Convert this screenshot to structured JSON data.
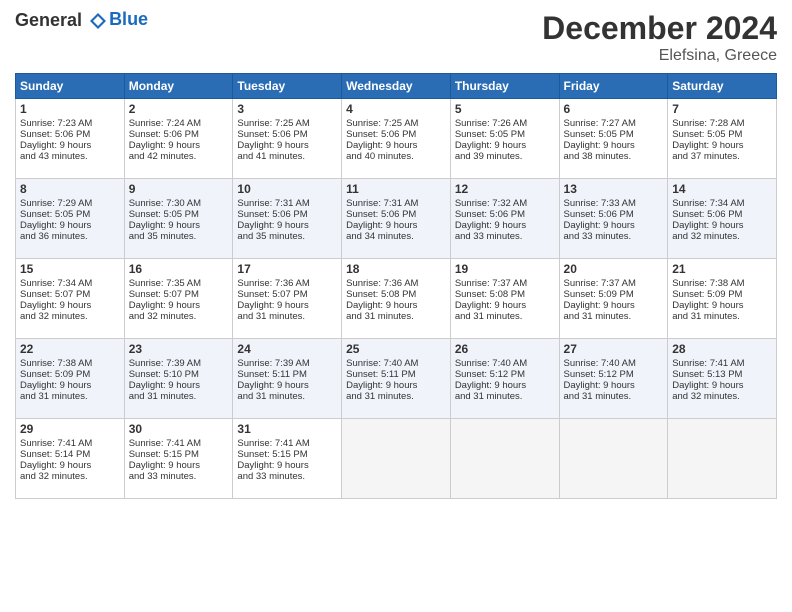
{
  "header": {
    "logo_line1": "General",
    "logo_line2": "Blue",
    "title": "December 2024",
    "location": "Elefsina, Greece"
  },
  "days_of_week": [
    "Sunday",
    "Monday",
    "Tuesday",
    "Wednesday",
    "Thursday",
    "Friday",
    "Saturday"
  ],
  "weeks": [
    [
      {
        "day": "1",
        "lines": [
          "Sunrise: 7:23 AM",
          "Sunset: 5:06 PM",
          "Daylight: 9 hours",
          "and 43 minutes."
        ]
      },
      {
        "day": "2",
        "lines": [
          "Sunrise: 7:24 AM",
          "Sunset: 5:06 PM",
          "Daylight: 9 hours",
          "and 42 minutes."
        ]
      },
      {
        "day": "3",
        "lines": [
          "Sunrise: 7:25 AM",
          "Sunset: 5:06 PM",
          "Daylight: 9 hours",
          "and 41 minutes."
        ]
      },
      {
        "day": "4",
        "lines": [
          "Sunrise: 7:25 AM",
          "Sunset: 5:06 PM",
          "Daylight: 9 hours",
          "and 40 minutes."
        ]
      },
      {
        "day": "5",
        "lines": [
          "Sunrise: 7:26 AM",
          "Sunset: 5:05 PM",
          "Daylight: 9 hours",
          "and 39 minutes."
        ]
      },
      {
        "day": "6",
        "lines": [
          "Sunrise: 7:27 AM",
          "Sunset: 5:05 PM",
          "Daylight: 9 hours",
          "and 38 minutes."
        ]
      },
      {
        "day": "7",
        "lines": [
          "Sunrise: 7:28 AM",
          "Sunset: 5:05 PM",
          "Daylight: 9 hours",
          "and 37 minutes."
        ]
      }
    ],
    [
      {
        "day": "8",
        "lines": [
          "Sunrise: 7:29 AM",
          "Sunset: 5:05 PM",
          "Daylight: 9 hours",
          "and 36 minutes."
        ]
      },
      {
        "day": "9",
        "lines": [
          "Sunrise: 7:30 AM",
          "Sunset: 5:05 PM",
          "Daylight: 9 hours",
          "and 35 minutes."
        ]
      },
      {
        "day": "10",
        "lines": [
          "Sunrise: 7:31 AM",
          "Sunset: 5:06 PM",
          "Daylight: 9 hours",
          "and 35 minutes."
        ]
      },
      {
        "day": "11",
        "lines": [
          "Sunrise: 7:31 AM",
          "Sunset: 5:06 PM",
          "Daylight: 9 hours",
          "and 34 minutes."
        ]
      },
      {
        "day": "12",
        "lines": [
          "Sunrise: 7:32 AM",
          "Sunset: 5:06 PM",
          "Daylight: 9 hours",
          "and 33 minutes."
        ]
      },
      {
        "day": "13",
        "lines": [
          "Sunrise: 7:33 AM",
          "Sunset: 5:06 PM",
          "Daylight: 9 hours",
          "and 33 minutes."
        ]
      },
      {
        "day": "14",
        "lines": [
          "Sunrise: 7:34 AM",
          "Sunset: 5:06 PM",
          "Daylight: 9 hours",
          "and 32 minutes."
        ]
      }
    ],
    [
      {
        "day": "15",
        "lines": [
          "Sunrise: 7:34 AM",
          "Sunset: 5:07 PM",
          "Daylight: 9 hours",
          "and 32 minutes."
        ]
      },
      {
        "day": "16",
        "lines": [
          "Sunrise: 7:35 AM",
          "Sunset: 5:07 PM",
          "Daylight: 9 hours",
          "and 32 minutes."
        ]
      },
      {
        "day": "17",
        "lines": [
          "Sunrise: 7:36 AM",
          "Sunset: 5:07 PM",
          "Daylight: 9 hours",
          "and 31 minutes."
        ]
      },
      {
        "day": "18",
        "lines": [
          "Sunrise: 7:36 AM",
          "Sunset: 5:08 PM",
          "Daylight: 9 hours",
          "and 31 minutes."
        ]
      },
      {
        "day": "19",
        "lines": [
          "Sunrise: 7:37 AM",
          "Sunset: 5:08 PM",
          "Daylight: 9 hours",
          "and 31 minutes."
        ]
      },
      {
        "day": "20",
        "lines": [
          "Sunrise: 7:37 AM",
          "Sunset: 5:09 PM",
          "Daylight: 9 hours",
          "and 31 minutes."
        ]
      },
      {
        "day": "21",
        "lines": [
          "Sunrise: 7:38 AM",
          "Sunset: 5:09 PM",
          "Daylight: 9 hours",
          "and 31 minutes."
        ]
      }
    ],
    [
      {
        "day": "22",
        "lines": [
          "Sunrise: 7:38 AM",
          "Sunset: 5:09 PM",
          "Daylight: 9 hours",
          "and 31 minutes."
        ]
      },
      {
        "day": "23",
        "lines": [
          "Sunrise: 7:39 AM",
          "Sunset: 5:10 PM",
          "Daylight: 9 hours",
          "and 31 minutes."
        ]
      },
      {
        "day": "24",
        "lines": [
          "Sunrise: 7:39 AM",
          "Sunset: 5:11 PM",
          "Daylight: 9 hours",
          "and 31 minutes."
        ]
      },
      {
        "day": "25",
        "lines": [
          "Sunrise: 7:40 AM",
          "Sunset: 5:11 PM",
          "Daylight: 9 hours",
          "and 31 minutes."
        ]
      },
      {
        "day": "26",
        "lines": [
          "Sunrise: 7:40 AM",
          "Sunset: 5:12 PM",
          "Daylight: 9 hours",
          "and 31 minutes."
        ]
      },
      {
        "day": "27",
        "lines": [
          "Sunrise: 7:40 AM",
          "Sunset: 5:12 PM",
          "Daylight: 9 hours",
          "and 31 minutes."
        ]
      },
      {
        "day": "28",
        "lines": [
          "Sunrise: 7:41 AM",
          "Sunset: 5:13 PM",
          "Daylight: 9 hours",
          "and 32 minutes."
        ]
      }
    ],
    [
      {
        "day": "29",
        "lines": [
          "Sunrise: 7:41 AM",
          "Sunset: 5:14 PM",
          "Daylight: 9 hours",
          "and 32 minutes."
        ]
      },
      {
        "day": "30",
        "lines": [
          "Sunrise: 7:41 AM",
          "Sunset: 5:15 PM",
          "Daylight: 9 hours",
          "and 33 minutes."
        ]
      },
      {
        "day": "31",
        "lines": [
          "Sunrise: 7:41 AM",
          "Sunset: 5:15 PM",
          "Daylight: 9 hours",
          "and 33 minutes."
        ]
      },
      null,
      null,
      null,
      null
    ]
  ]
}
